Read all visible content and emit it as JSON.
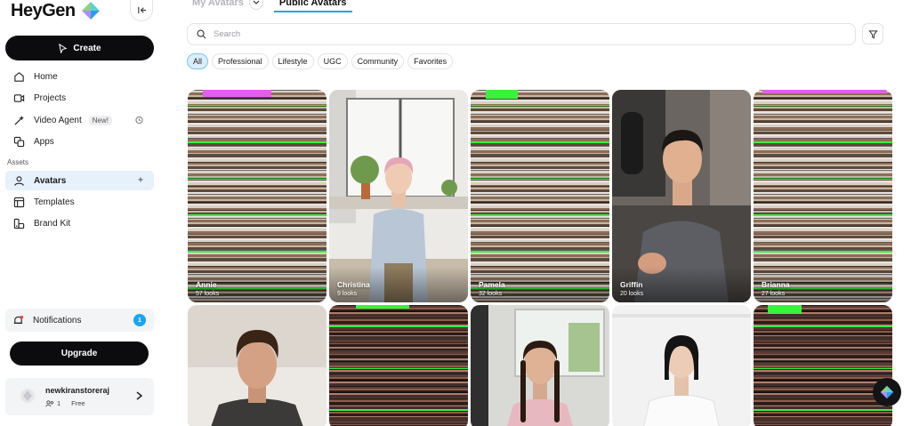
{
  "app": {
    "logo_text": "HeyGen"
  },
  "sidebar": {
    "create_label": "Create",
    "nav": [
      {
        "label": "Home",
        "icon": "home-icon"
      },
      {
        "label": "Projects",
        "icon": "projects-icon"
      },
      {
        "label": "Video Agent",
        "icon": "video-agent-icon",
        "badge": "New!"
      },
      {
        "label": "Apps",
        "icon": "apps-icon"
      }
    ],
    "section_label": "Assets",
    "assets": [
      {
        "label": "Avatars",
        "icon": "user-icon",
        "active": true,
        "trail": "+"
      },
      {
        "label": "Templates",
        "icon": "templates-icon"
      },
      {
        "label": "Brand Kit",
        "icon": "brand-kit-icon"
      }
    ],
    "notifications": {
      "label": "Notifications",
      "count": "1"
    },
    "upgrade_label": "Upgrade",
    "account": {
      "name": "newkiranstoreraj",
      "members": "1",
      "plan": "Free"
    }
  },
  "main": {
    "tabs": [
      {
        "label": "My Avatars",
        "active": false
      },
      {
        "label": "Public Avatars",
        "active": true
      }
    ],
    "search": {
      "placeholder": "Search",
      "value": ""
    },
    "filters": [
      "All",
      "Professional",
      "Lifestyle",
      "UGC",
      "Community",
      "Favorites"
    ],
    "active_filter": "All",
    "avatars": [
      {
        "name": "Annie",
        "looks": "57 looks"
      },
      {
        "name": "Christina",
        "looks": "9 looks"
      },
      {
        "name": "Pamela",
        "looks": "32 looks"
      },
      {
        "name": "Griffin",
        "looks": "20 looks"
      },
      {
        "name": "Brianna",
        "looks": "27 looks"
      }
    ]
  },
  "colors": {
    "accent": "#1aa6ef",
    "dark": "#0c0c0f",
    "active_bg": "#e6f1fc"
  }
}
